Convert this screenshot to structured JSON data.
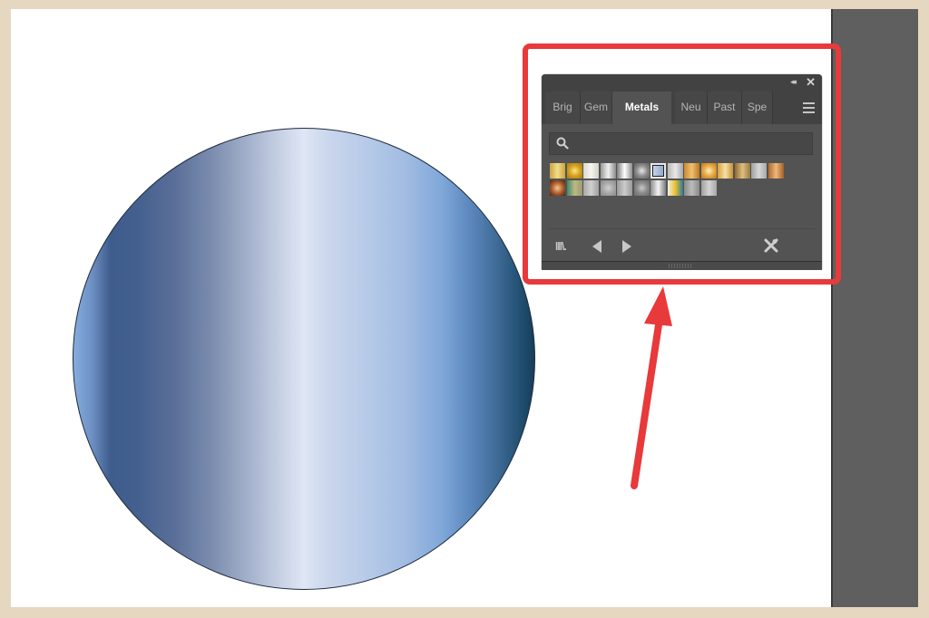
{
  "canvas": {
    "artwork": "circle-with-metallic-blue-gradient",
    "gradient_colors": [
      "#86aedd",
      "#3e5c8c",
      "#7b8cae",
      "#dfe6f5",
      "#a2bce2",
      "#7fa7d9",
      "#173e5a"
    ]
  },
  "annotation": {
    "highlight_color": "#e8393b"
  },
  "swatches_panel": {
    "collapse_icon": "double-chevron-left-icon",
    "close_icon": "close-icon",
    "collapse_label": "◂◂",
    "close_label": "✕",
    "tabs": [
      {
        "label": "Brig",
        "active": false
      },
      {
        "label": "Gem",
        "active": false
      },
      {
        "label": "Metals",
        "active": true
      },
      {
        "label": "Neu",
        "active": false
      },
      {
        "label": "Past",
        "active": false
      },
      {
        "label": "Spe",
        "active": false
      }
    ],
    "search": {
      "value": "",
      "placeholder": ""
    },
    "swatch_rows": [
      [
        {
          "colors": [
            "#c9a440",
            "#f2dc8a",
            "#c9a440"
          ],
          "type": "linear"
        },
        {
          "colors": [
            "#ffe680",
            "#d4a020",
            "#a27a15"
          ],
          "type": "radial"
        },
        {
          "colors": [
            "#d8d8d0",
            "#f6f6f0",
            "#d0d0c8"
          ],
          "type": "linear"
        },
        {
          "colors": [
            "#9a9a9a",
            "#f0f0f0",
            "#8a8a8a"
          ],
          "type": "linear"
        },
        {
          "colors": [
            "#7a7a7a",
            "#ffffff",
            "#8d8d8d"
          ],
          "type": "linear"
        },
        {
          "colors": [
            "#e8e8e8",
            "#8c8c8c",
            "#5e5e5e"
          ],
          "type": "radial"
        },
        {
          "colors": [
            "#c5d4ec",
            "#93a9cc"
          ],
          "type": "linear",
          "selected": true
        },
        {
          "colors": [
            "#b8b8b8",
            "#e8e8e8",
            "#a8a8a8"
          ],
          "type": "linear"
        },
        {
          "colors": [
            "#c88a30",
            "#f0c070",
            "#b87a20"
          ],
          "type": "linear"
        },
        {
          "colors": [
            "#fff0c0",
            "#e8a840",
            "#b87820"
          ],
          "type": "radial"
        },
        {
          "colors": [
            "#d8a040",
            "#f8e0a8",
            "#c89030"
          ],
          "type": "linear"
        },
        {
          "colors": [
            "#8a6a30",
            "#e0c080",
            "#9a7a40"
          ],
          "type": "linear"
        },
        {
          "colors": [
            "#a0a0a0",
            "#d8d8d8",
            "#a8a8a8"
          ],
          "type": "linear"
        },
        {
          "colors": [
            "#b06a30",
            "#f0b878",
            "#a06028"
          ],
          "type": "linear"
        }
      ],
      [
        {
          "colors": [
            "#f8c890",
            "#b06030",
            "#4a2010"
          ],
          "type": "radial"
        },
        {
          "colors": [
            "#3a8a70",
            "#c0b880",
            "#9a9a78"
          ],
          "type": "linear"
        },
        {
          "colors": [
            "#a8a8a8",
            "#d0d0d0",
            "#a0a0a0"
          ],
          "type": "linear"
        },
        {
          "colors": [
            "#d0d0d0",
            "#a8a8a8",
            "#8a8a8a"
          ],
          "type": "radial"
        },
        {
          "colors": [
            "#9a9a9a",
            "#cccccc",
            "#9a9a9a"
          ],
          "type": "linear"
        },
        {
          "colors": [
            "#c8c8c8",
            "#8a8a8a",
            "#6a6a6a"
          ],
          "type": "radial"
        },
        {
          "colors": [
            "#8a8a8a",
            "#f4f4f4",
            "#7a7a7a"
          ],
          "type": "linear"
        },
        {
          "colors": [
            "#f0f0e0",
            "#e8c030",
            "#2a7a9a"
          ],
          "type": "linear"
        },
        {
          "colors": [
            "#8a8a8a",
            "#bbbbbb",
            "#8a8a8a"
          ],
          "type": "linear"
        },
        {
          "colors": [
            "#a0a0a0",
            "#d4d4d4",
            "#a8a8a8"
          ],
          "type": "linear"
        }
      ]
    ],
    "bottom_toolbar": {
      "library_label": "lll\\.",
      "library_icon": "swatch-libraries-menu-icon",
      "prev_icon": "previous-library-icon",
      "next_icon": "next-library-icon",
      "delete_icon": "delete-swatch-icon"
    }
  }
}
